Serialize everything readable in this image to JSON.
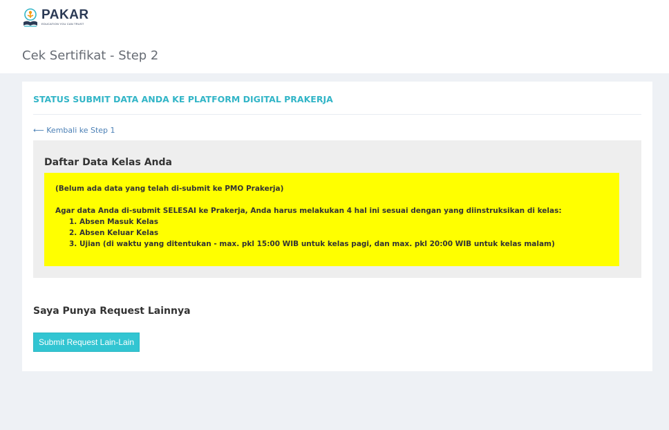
{
  "brand": {
    "name": "PAKAR",
    "tagline": "EDUCATION YOU CAN TRUST",
    "colors": {
      "primary": "#2b3a55",
      "accent_orange": "#f39c12",
      "accent_teal": "#32b5c7"
    }
  },
  "page": {
    "title": "Cek Sertifikat - Step 2"
  },
  "card": {
    "title": "STATUS SUBMIT DATA ANDA KE PLATFORM DIGITAL PRAKERJA",
    "back_link": "⟵ Kembali ke Step 1"
  },
  "class_data": {
    "title": "Daftar Data Kelas Anda",
    "notice": {
      "empty_message": "(Belum ada data yang telah di-submit ke PMO Prakerja)",
      "instruction": "Agar data Anda di-submit SELESAI ke Prakerja, Anda harus melakukan 4 hal ini sesuai dengan yang diinstruksikan di kelas:",
      "steps": [
        "1. Absen Masuk Kelas",
        "2. Absen Keluar Kelas",
        "3. Ujian (di waktu yang ditentukan - max. pkl 15:00 WIB untuk kelas pagi, dan max. pkl 20:00 WIB untuk kelas malam)"
      ],
      "background": "#ffff00"
    }
  },
  "request": {
    "title": "Saya Punya Request Lainnya",
    "button_label": "Submit Request Lain-Lain",
    "button_color": "#32c5d2"
  }
}
